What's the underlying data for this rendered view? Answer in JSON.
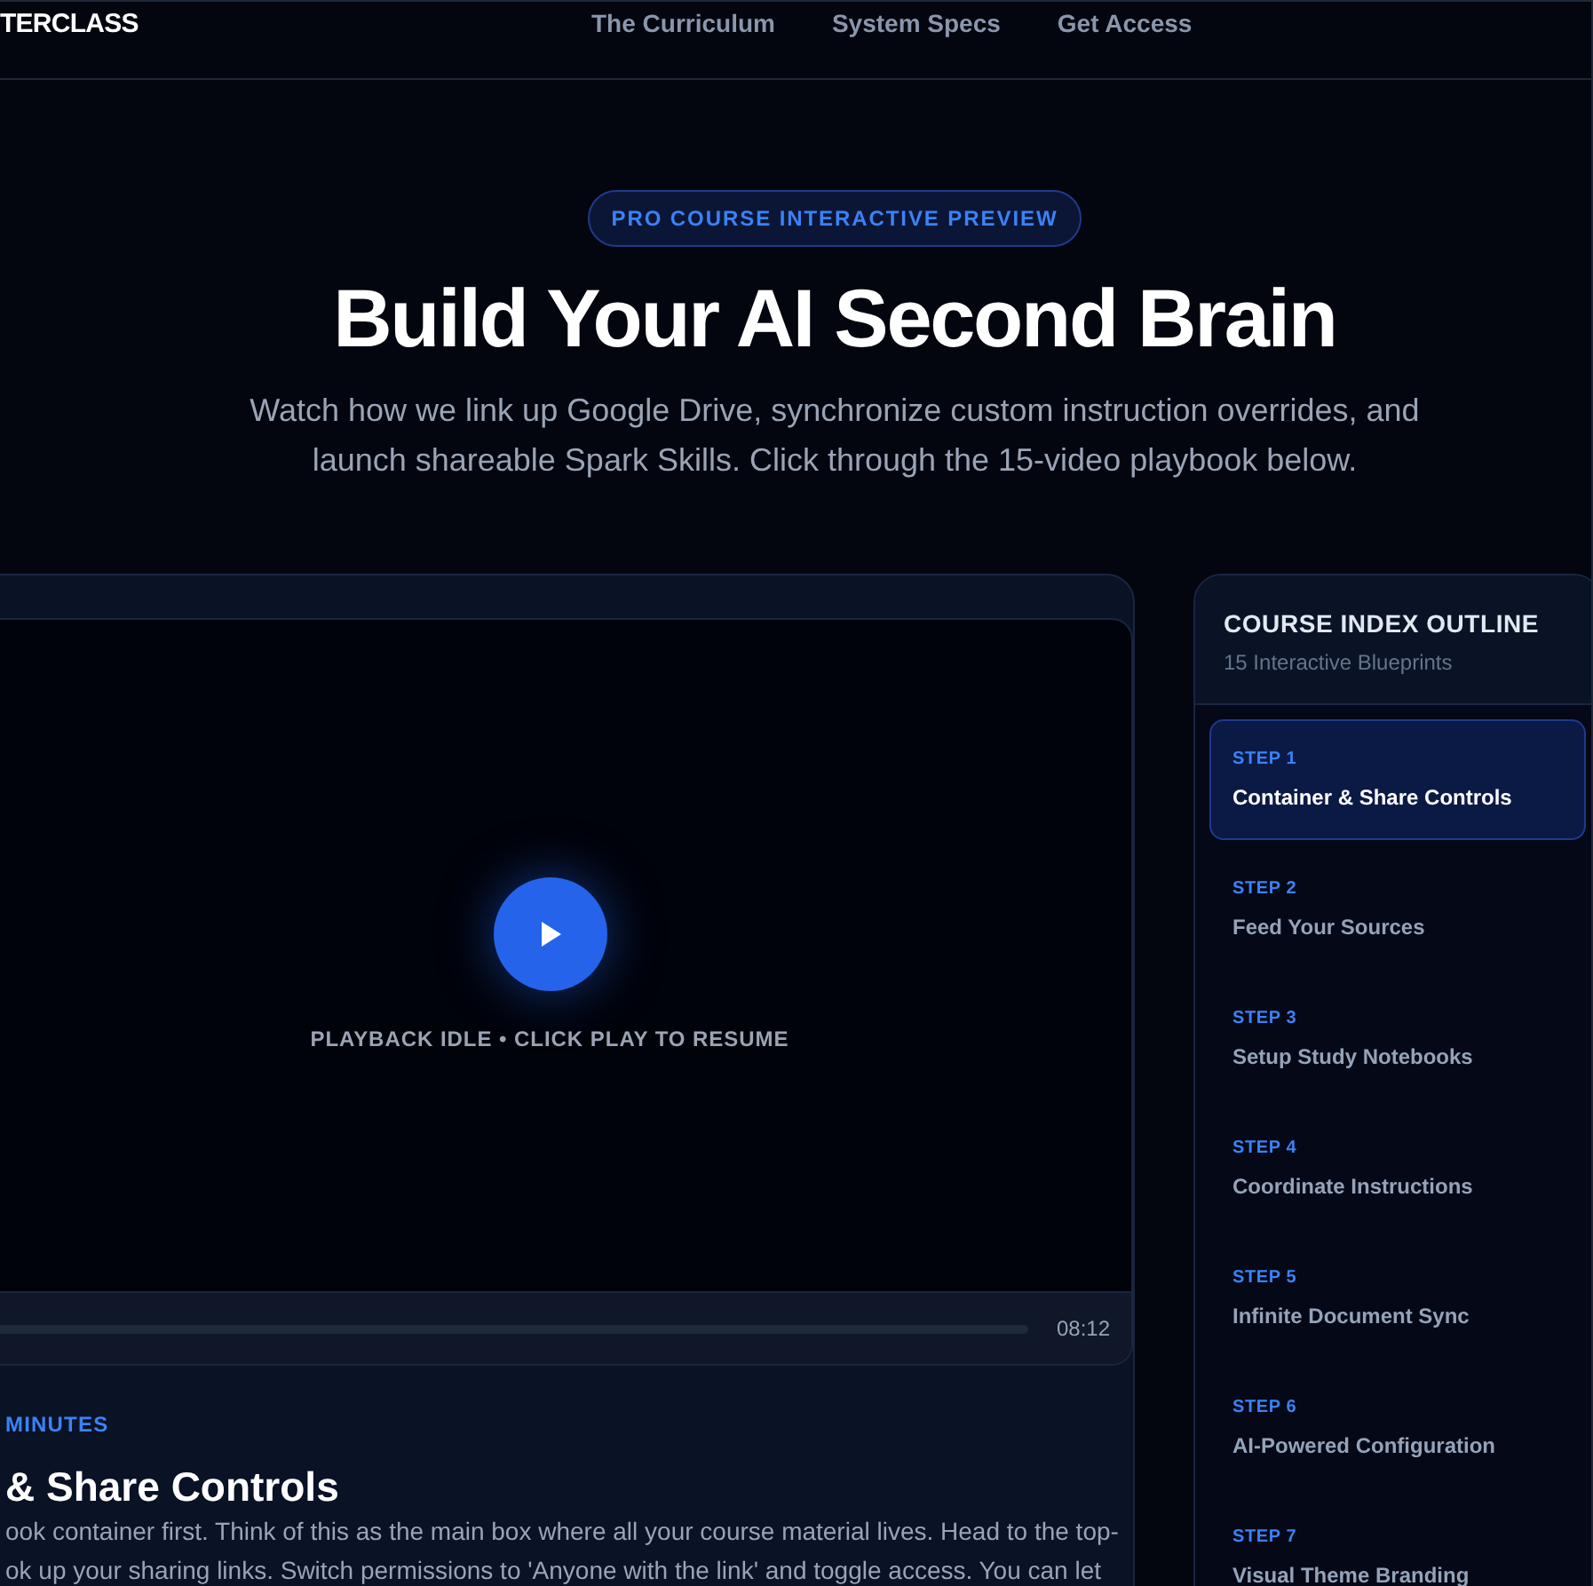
{
  "brand": "TERCLASS",
  "nav": [
    {
      "label": "The Curriculum"
    },
    {
      "label": "System Specs"
    },
    {
      "label": "Get Access"
    }
  ],
  "hero": {
    "badge": "PRO COURSE INTERACTIVE PREVIEW",
    "title": "Build Your AI Second Brain",
    "subtitle": "Watch how we link up Google Drive, synchronize custom instruction overrides, and launch shareable Spark Skills. Click through the 15-video playbook below."
  },
  "player": {
    "status": "PLAYBACK IDLE • CLICK PLAY TO RESUME",
    "level": 0,
    "duration": "08:12"
  },
  "lesson": {
    "meta": "MINUTES",
    "title": "& Share Controls",
    "lines": [
      "ook container first. Think of this as the main box where all your course material lives. Head to the top-",
      "ok up your sharing links. Switch permissions to 'Anyone with the link' and toggle access. You can let"
    ]
  },
  "outline": {
    "title": "COURSE INDEX OUTLINE",
    "subtitle": "15 Interactive Blueprints",
    "items": [
      {
        "step": "STEP 1",
        "title": "Container & Share Controls",
        "selected": true
      },
      {
        "step": "STEP 2",
        "title": "Feed Your Sources",
        "selected": false
      },
      {
        "step": "STEP 3",
        "title": "Setup Study Notebooks",
        "selected": false
      },
      {
        "step": "STEP 4",
        "title": "Coordinate Instructions",
        "selected": false
      },
      {
        "step": "STEP 5",
        "title": "Infinite Document Sync",
        "selected": false
      },
      {
        "step": "STEP 6",
        "title": "AI-Powered Configuration",
        "selected": false
      },
      {
        "step": "STEP 7",
        "title": "Visual Theme Branding",
        "selected": false
      }
    ]
  }
}
